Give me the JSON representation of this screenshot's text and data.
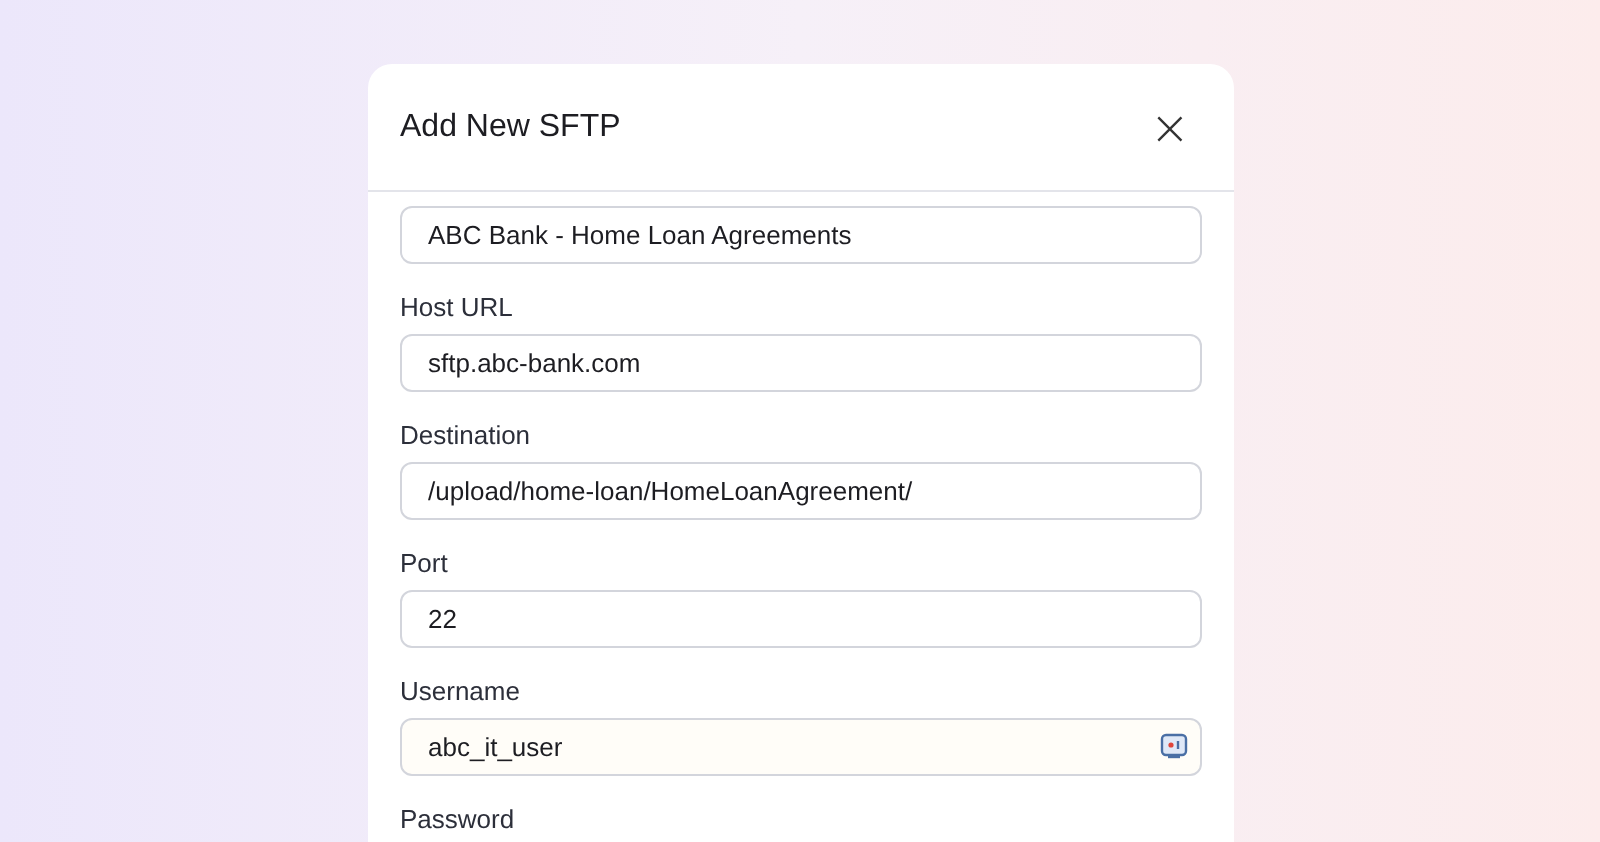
{
  "dialog": {
    "title": "Add New SFTP",
    "close": "×"
  },
  "fields": [
    {
      "kind": "plain",
      "value": "ABC Bank - Home Loan Agreements"
    },
    {
      "kind": "plain",
      "label": "Host URL",
      "value": "sftp.abc-bank.com"
    },
    {
      "kind": "plain",
      "label": "Destination",
      "value": "/upload/home-loan/HomeLoanAgreement/"
    },
    {
      "kind": "plain",
      "label": "Port",
      "value": "22"
    },
    {
      "kind": "with-icon",
      "label": "Username",
      "value": "abc_it_user"
    },
    {
      "kind": "plain",
      "label": "Password"
    }
  ]
}
